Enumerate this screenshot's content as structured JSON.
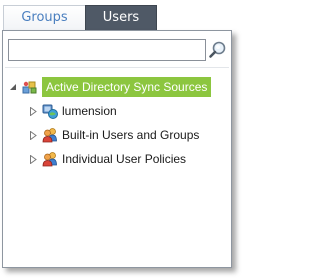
{
  "tabs": [
    {
      "label": "Groups",
      "active": false
    },
    {
      "label": "Users",
      "active": true
    }
  ],
  "search": {
    "value": "",
    "placeholder": "",
    "icon": "search-icon"
  },
  "tree": {
    "root": {
      "label": "Active Directory Sync Sources",
      "icon": "directory-sync-icon",
      "expanded": true,
      "selected": true
    },
    "children": [
      {
        "label": "lumension",
        "icon": "domain-icon",
        "expanded": false
      },
      {
        "label": "Built-in Users and Groups",
        "icon": "user-group-icon",
        "expanded": false
      },
      {
        "label": "Individual User Policies",
        "icon": "user-group-icon",
        "expanded": false
      }
    ]
  },
  "colors": {
    "selection": "#8cc63f",
    "active_tab": "#4f5966",
    "inactive_tab_text": "#4a7fbf"
  }
}
